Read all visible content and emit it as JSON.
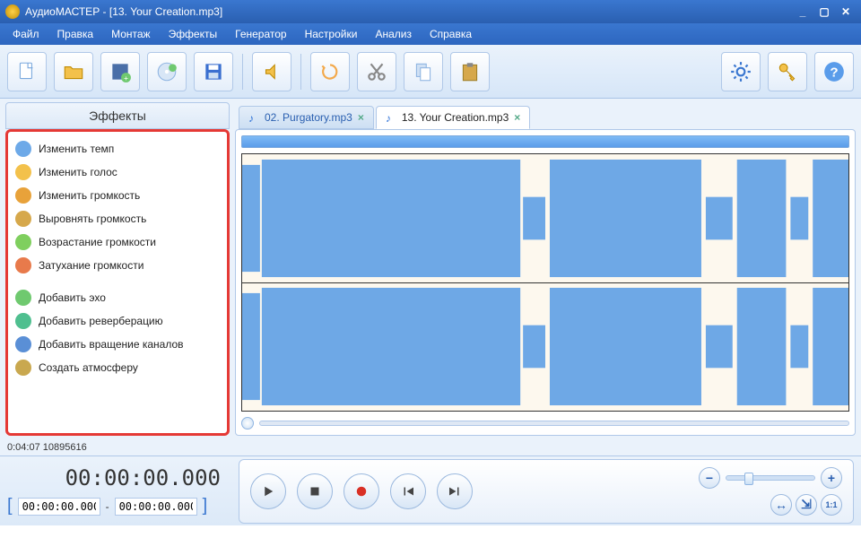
{
  "title": "АудиоМАСТЕР - [13. Your Creation.mp3]",
  "menu": [
    "Файл",
    "Правка",
    "Монтаж",
    "Эффекты",
    "Генератор",
    "Настройки",
    "Анализ",
    "Справка"
  ],
  "sidebar": {
    "header": "Эффекты",
    "items": [
      {
        "label": "Изменить темп",
        "color": "#6da9e8"
      },
      {
        "label": "Изменить голос",
        "color": "#f3c14b"
      },
      {
        "label": "Изменить громкость",
        "color": "#e8a23a"
      },
      {
        "label": "Выровнять громкость",
        "color": "#d6a84b"
      },
      {
        "label": "Возрастание громкости",
        "color": "#7fcf5e"
      },
      {
        "label": "Затухание громкости",
        "color": "#e87a4b"
      }
    ],
    "items2": [
      {
        "label": "Добавить эхо",
        "color": "#6fc96f"
      },
      {
        "label": "Добавить реверберацию",
        "color": "#4fbf8f"
      },
      {
        "label": "Добавить вращение каналов",
        "color": "#5a8fd6"
      },
      {
        "label": "Создать атмосферу",
        "color": "#c9a84f"
      }
    ]
  },
  "tabs": [
    {
      "label": "02. Purgatory.mp3",
      "active": false
    },
    {
      "label": "13. Your Creation.mp3",
      "active": true
    }
  ],
  "status": "0:04:07 10895616",
  "time": {
    "big": "00:00:00.000",
    "from": "00:00:00.000",
    "to": "00:00:00.000",
    "sep": "-"
  },
  "zoom": {
    "fit_label": "1:1"
  }
}
